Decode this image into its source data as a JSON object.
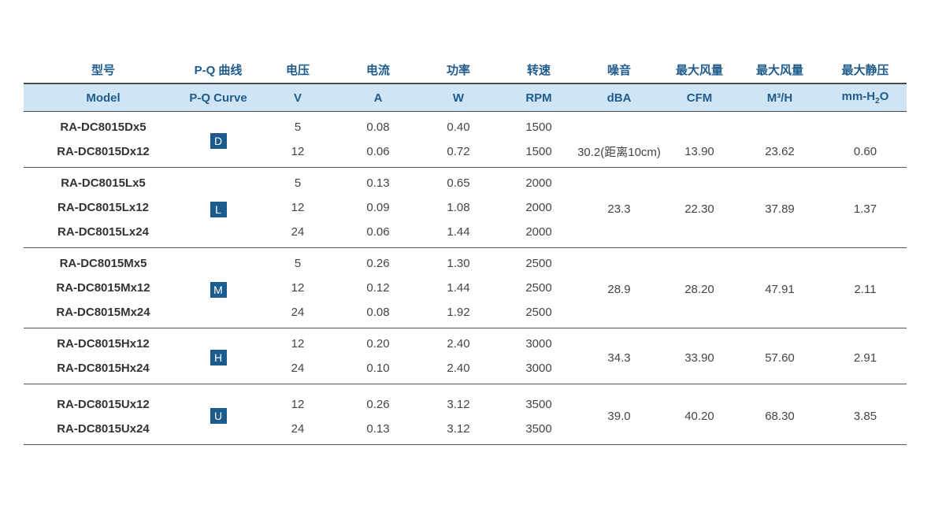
{
  "headers_zh": [
    "型号",
    "P-Q 曲线",
    "电压",
    "电流",
    "功率",
    "转速",
    "噪音",
    "最大风量",
    "最大风量",
    "最大静压"
  ],
  "headers_en": [
    "Model",
    "P-Q Curve",
    "V",
    "A",
    "W",
    "RPM",
    "dBA",
    "CFM",
    "M³/H",
    "mm-H",
    "2",
    "O"
  ],
  "groups": [
    {
      "curve": "D",
      "dba": "30.2(距离10cm)",
      "cfm": "13.90",
      "m3h": "23.62",
      "pressure": "0.60",
      "rows": [
        {
          "model": "RA-DC8015Dx5",
          "v": "5",
          "a": "0.08",
          "w": "0.40",
          "rpm": "1500"
        },
        {
          "model": "RA-DC8015Dx12",
          "v": "12",
          "a": "0.06",
          "w": "0.72",
          "rpm": "1500"
        }
      ]
    },
    {
      "curve": "L",
      "dba": "23.3",
      "cfm": "22.30",
      "m3h": "37.89",
      "pressure": "1.37",
      "rows": [
        {
          "model": "RA-DC8015Lx5",
          "v": "5",
          "a": "0.13",
          "w": "0.65",
          "rpm": "2000"
        },
        {
          "model": "RA-DC8015Lx12",
          "v": "12",
          "a": "0.09",
          "w": "1.08",
          "rpm": "2000"
        },
        {
          "model": "RA-DC8015Lx24",
          "v": "24",
          "a": "0.06",
          "w": "1.44",
          "rpm": "2000"
        }
      ]
    },
    {
      "curve": "M",
      "dba": "28.9",
      "cfm": "28.20",
      "m3h": "47.91",
      "pressure": "2.11",
      "rows": [
        {
          "model": "RA-DC8015Mx5",
          "v": "5",
          "a": "0.26",
          "w": "1.30",
          "rpm": "2500"
        },
        {
          "model": "RA-DC8015Mx12",
          "v": "12",
          "a": "0.12",
          "w": "1.44",
          "rpm": "2500"
        },
        {
          "model": "RA-DC8015Mx24",
          "v": "24",
          "a": "0.08",
          "w": "1.92",
          "rpm": "2500"
        }
      ]
    },
    {
      "curve": "H",
      "dba": "34.3",
      "cfm": "33.90",
      "m3h": "57.60",
      "pressure": "2.91",
      "rows": [
        {
          "model": "RA-DC8015Hx12",
          "v": "12",
          "a": "0.20",
          "w": "2.40",
          "rpm": "3000"
        },
        {
          "model": "RA-DC8015Hx24",
          "v": "24",
          "a": "0.10",
          "w": "2.40",
          "rpm": "3000"
        }
      ]
    },
    {
      "curve": "U",
      "dba": "39.0",
      "cfm": "40.20",
      "m3h": "68.30",
      "pressure": "3.85",
      "rows": [
        {
          "model": "RA-DC8015Ux12",
          "v": "12",
          "a": "0.26",
          "w": "3.12",
          "rpm": "3500"
        },
        {
          "model": "RA-DC8015Ux24",
          "v": "24",
          "a": "0.13",
          "w": "3.12",
          "rpm": "3500"
        }
      ]
    }
  ],
  "colors": {
    "accent": "#1f5c8c",
    "header_bg": "#cfe5f5",
    "badge": "#1b5b8e"
  }
}
